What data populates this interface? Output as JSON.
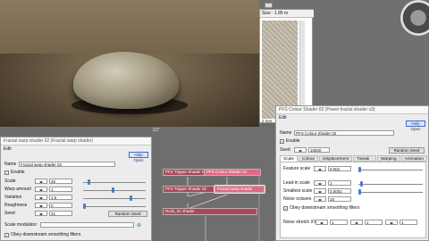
{
  "render_view": {},
  "size_panel": {
    "size_label": "Size : 1.85 m",
    "footer": "2 mm"
  },
  "fractal_warp": {
    "title": "Fractal warp shader 02   (Fractal warp shader)",
    "menu": "Edit",
    "help": "Help Open",
    "name_label": "Name",
    "name_value": "Fractal warp shader 02",
    "enable_label": "Enable",
    "rows": [
      {
        "label": "Scale",
        "value": "20"
      },
      {
        "label": "Warp amount",
        "value": "1"
      },
      {
        "label": "Variation",
        "value": "1.5"
      },
      {
        "label": "Roughness",
        "value": "0"
      },
      {
        "label": "Seed",
        "value": "21"
      }
    ],
    "random_seed": "Random Seed",
    "scale_modulator": "Scale modulator",
    "obey": "Obey downstream smoothing filters"
  },
  "graph": {
    "top_label": "21*",
    "nodes": [
      {
        "label": "PFS Tripper Shader 01"
      },
      {
        "label": "PFS Colour Shader 01"
      },
      {
        "label": "PFS Tripper Shader 02"
      },
      {
        "label": "Fractal warp shader"
      },
      {
        "label": "Rock_01 shader"
      }
    ]
  },
  "colour_shader": {
    "title": "PFS Colour Shader 02   (Power fractal shader v3)",
    "menu": "Edit",
    "help": "Help Open",
    "name_label": "Name",
    "name_value": "PFS Colour Shader 02",
    "enable_label": "Enable",
    "seed_label": "Seed",
    "seed_value": "15500",
    "random_seed": "Random Seed",
    "tabs": [
      "Scale",
      "Colour",
      "Displacement",
      "Tweak Noise",
      "Warping",
      "Animation"
    ],
    "rows": [
      {
        "label": "Feature scale",
        "value": "0.001"
      },
      {
        "label": "Lead-in scale",
        "value": "1"
      },
      {
        "label": "Smallest scale",
        "value": "0.0001"
      },
      {
        "label": "Noise octaves",
        "value": "15"
      }
    ],
    "obey": "Obey downstream smoothing filters",
    "noise_stretch_label": "Noise stretch XYZ",
    "noise_stretch": [
      "1",
      "1",
      "1"
    ]
  }
}
